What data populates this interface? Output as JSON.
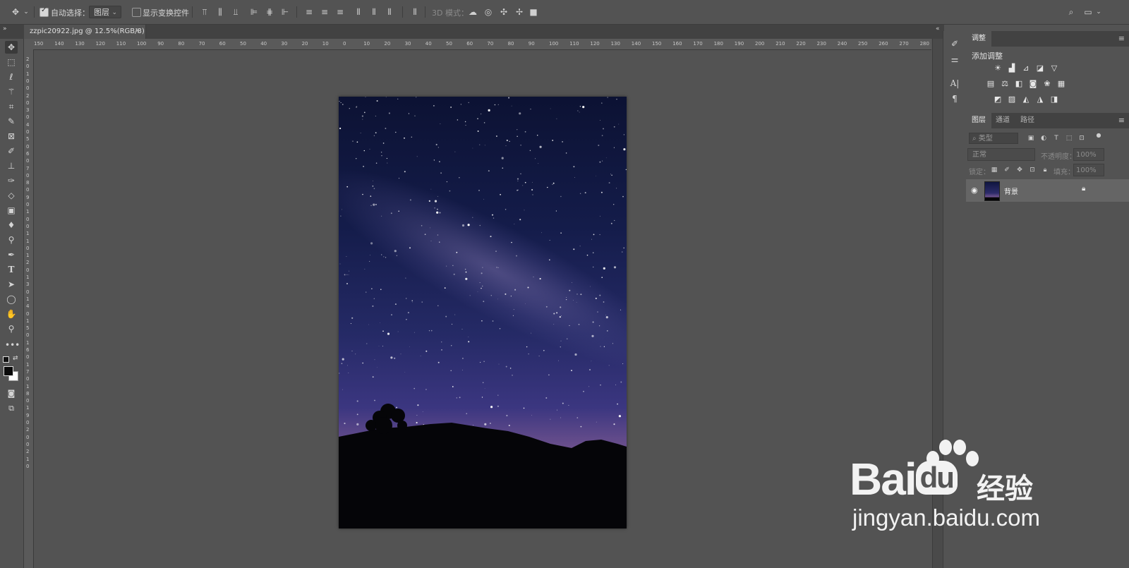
{
  "options_bar": {
    "move_icon": "move-icon",
    "auto_select_label": "自动选择：",
    "auto_select_checked": true,
    "auto_select_target": "图层",
    "show_transform_label": "显示变换控件",
    "show_transform_checked": false,
    "mode_3d_label": "3D 模式："
  },
  "document": {
    "tab_title": "zzpic20922.jpg @ 12.5%(RGB/8)",
    "close": "×"
  },
  "rulers": {
    "horizontal": [
      "150",
      "140",
      "130",
      "120",
      "110",
      "100",
      "90",
      "80",
      "70",
      "60",
      "50",
      "40",
      "30",
      "20",
      "10",
      "0",
      "10",
      "20",
      "30",
      "40",
      "50",
      "60",
      "70",
      "80",
      "90",
      "100",
      "110",
      "120",
      "130",
      "140",
      "150",
      "160",
      "170",
      "180",
      "190",
      "200",
      "210",
      "220",
      "230",
      "240",
      "250",
      "260",
      "270",
      "280"
    ],
    "vertical": [
      "2",
      "0",
      "1",
      "0",
      "0",
      "2",
      "0",
      "3",
      "0",
      "4",
      "0",
      "5",
      "0",
      "6",
      "0",
      "7",
      "0",
      "8",
      "0",
      "9",
      "0",
      "1",
      "0",
      "0",
      "1",
      "1",
      "0",
      "1",
      "2",
      "0",
      "1",
      "3",
      "0",
      "1",
      "4",
      "0",
      "1",
      "5",
      "0",
      "1",
      "6",
      "0",
      "1",
      "7",
      "0",
      "1",
      "8",
      "0",
      "1",
      "9",
      "0",
      "2",
      "0",
      "0",
      "2",
      "1",
      "0"
    ]
  },
  "tools": [
    "move-tool",
    "marquee-tool",
    "lasso-tool",
    "magic-wand-tool",
    "crop-tool",
    "eyedropper-tool",
    "frame-tool",
    "brush-tool",
    "clone-stamp-tool",
    "history-brush-tool",
    "eraser-tool",
    "gradient-tool",
    "blur-tool",
    "dodge-tool",
    "pen-tool",
    "type-tool",
    "path-select-tool",
    "ellipse-tool",
    "hand-tool",
    "zoom-tool",
    "more-tools"
  ],
  "adjustments_panel": {
    "tab": "调整",
    "heading": "添加调整"
  },
  "layers_panel": {
    "tabs": [
      "图层",
      "通道",
      "路径"
    ],
    "filter_placeholder": "类型",
    "blend_mode": "正常",
    "opacity_label": "不透明度：",
    "opacity_value": "100%",
    "lock_label": "锁定：",
    "fill_label": "填充：",
    "fill_value": "100%",
    "layers": [
      {
        "name": "背景",
        "visible": true,
        "locked": true
      }
    ]
  },
  "watermark": {
    "brand": "Bai",
    "brand_suffix": "du",
    "product": "经验",
    "url": "jingyan.baidu.com"
  }
}
